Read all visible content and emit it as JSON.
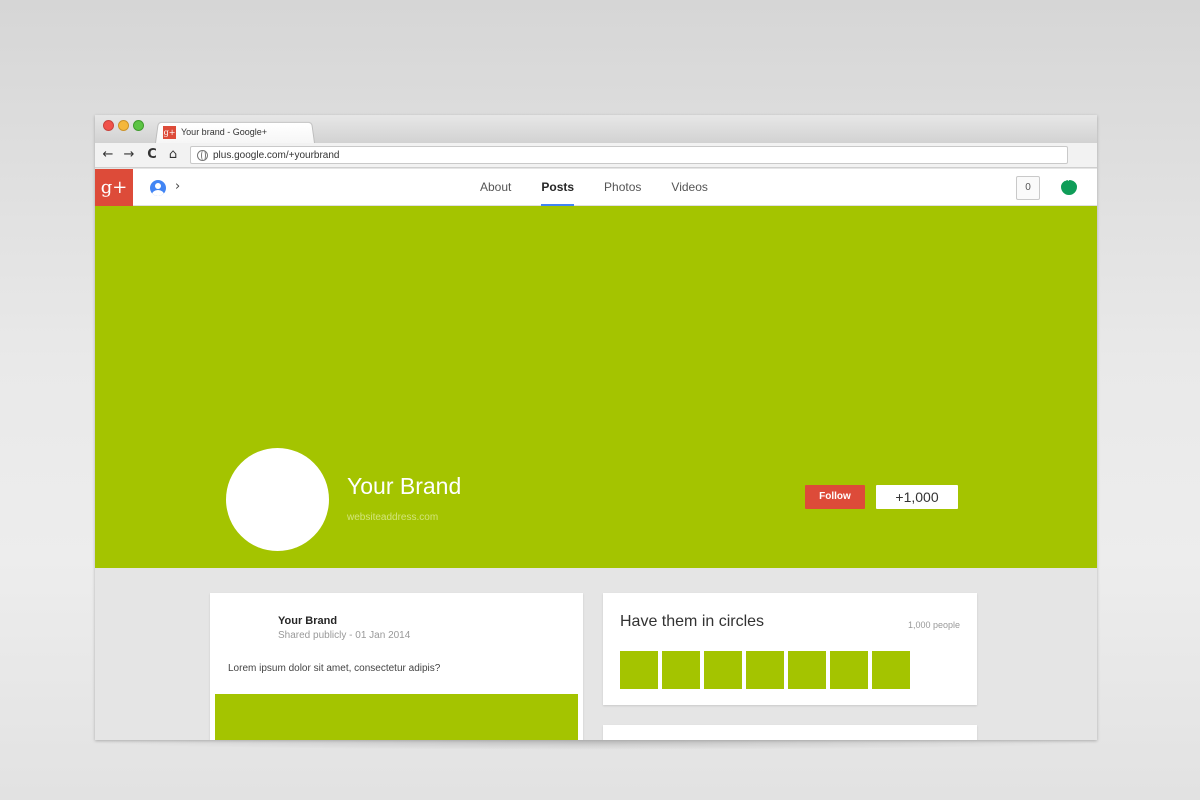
{
  "browser": {
    "tab_title": "Your brand - Google+",
    "tab_favicon": "g+",
    "url": "plus.google.com/+yourbrand",
    "nav": {
      "back": "←",
      "forward": "→",
      "reload": "C",
      "home": "⌂"
    }
  },
  "header": {
    "logo": "g+",
    "nav_tabs": [
      {
        "label": "About",
        "active": false
      },
      {
        "label": "Posts",
        "active": true
      },
      {
        "label": "Photos",
        "active": false
      },
      {
        "label": "Videos",
        "active": false
      }
    ],
    "notification_count": "0",
    "chevron": "›"
  },
  "cover": {
    "brand_name": "Your Brand",
    "website": "websiteaddress.com",
    "follow_label": "Follow",
    "plusone_label": "+1,000"
  },
  "post": {
    "author": "Your Brand",
    "meta": "Shared publicly  -  01 Jan 2014",
    "text": "Lorem ipsum dolor sit amet, consectetur adipis?"
  },
  "circles": {
    "title": "Have them in circles",
    "count": "1,000 people",
    "member_count": 7
  },
  "colors": {
    "brand_green": "#a4c400",
    "gplus_red": "#dd4b39",
    "tab_indicator": "#4285f4"
  },
  "icons": [
    "globe-icon",
    "profile-switch-icon",
    "hangouts-icon",
    "gplus-logo-icon"
  ]
}
